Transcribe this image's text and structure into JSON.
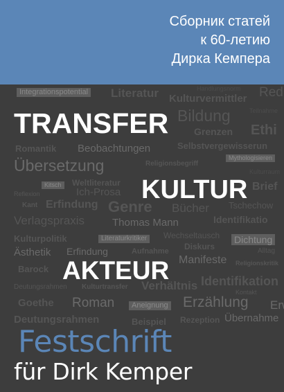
{
  "subtitle": [
    "Сборник статей",
    "к 60-летию",
    "Дирка Кемпера"
  ],
  "keywords": {
    "title": "TRANSFER",
    "culture": "KULTUR",
    "actor": "AKTEUR"
  },
  "series": {
    "festschrift": "Festschrift",
    "for_name": "für Dirk Kemper"
  },
  "word_cloud": [
    "Integrationspotential",
    "Literatur",
    "Handlungsnorm",
    "Red",
    "Kulturvermittler",
    "Bildung",
    "Teilnahme",
    "Grenzen",
    "Ethi",
    "Romantik",
    "Beobachtungen",
    "Selbstvergewisserun",
    "Übersetzung",
    "Religionsbegriff",
    "Mythologisieren",
    "Kulturraum",
    "Kitsch",
    "Weltliteratur",
    "Brief",
    "Reflexion",
    "Ich-Prosa",
    "Kant",
    "Erfindung",
    "Genre",
    "Bücher",
    "Tschechow",
    "Verlagspraxis",
    "Thomas Mann",
    "Identifikatio",
    "Kulturpolitik",
    "Literaturkritiker",
    "Wechseltausch",
    "Dichtung",
    "Ästhetik",
    "Erfindung",
    "Aufnahme",
    "Diskurs",
    "Alltag",
    "Barock",
    "Manifeste",
    "Religionskritik",
    "Deutungsrahmen",
    "Kulturtransfer",
    "Verhältnis",
    "Identifikation",
    "Kontakt",
    "Goethe",
    "Roman",
    "Aneignung",
    "Erzählung",
    "Erwe",
    "Deutungsrahmen",
    "Beispiel",
    "Rezeption",
    "Übernahme"
  ]
}
